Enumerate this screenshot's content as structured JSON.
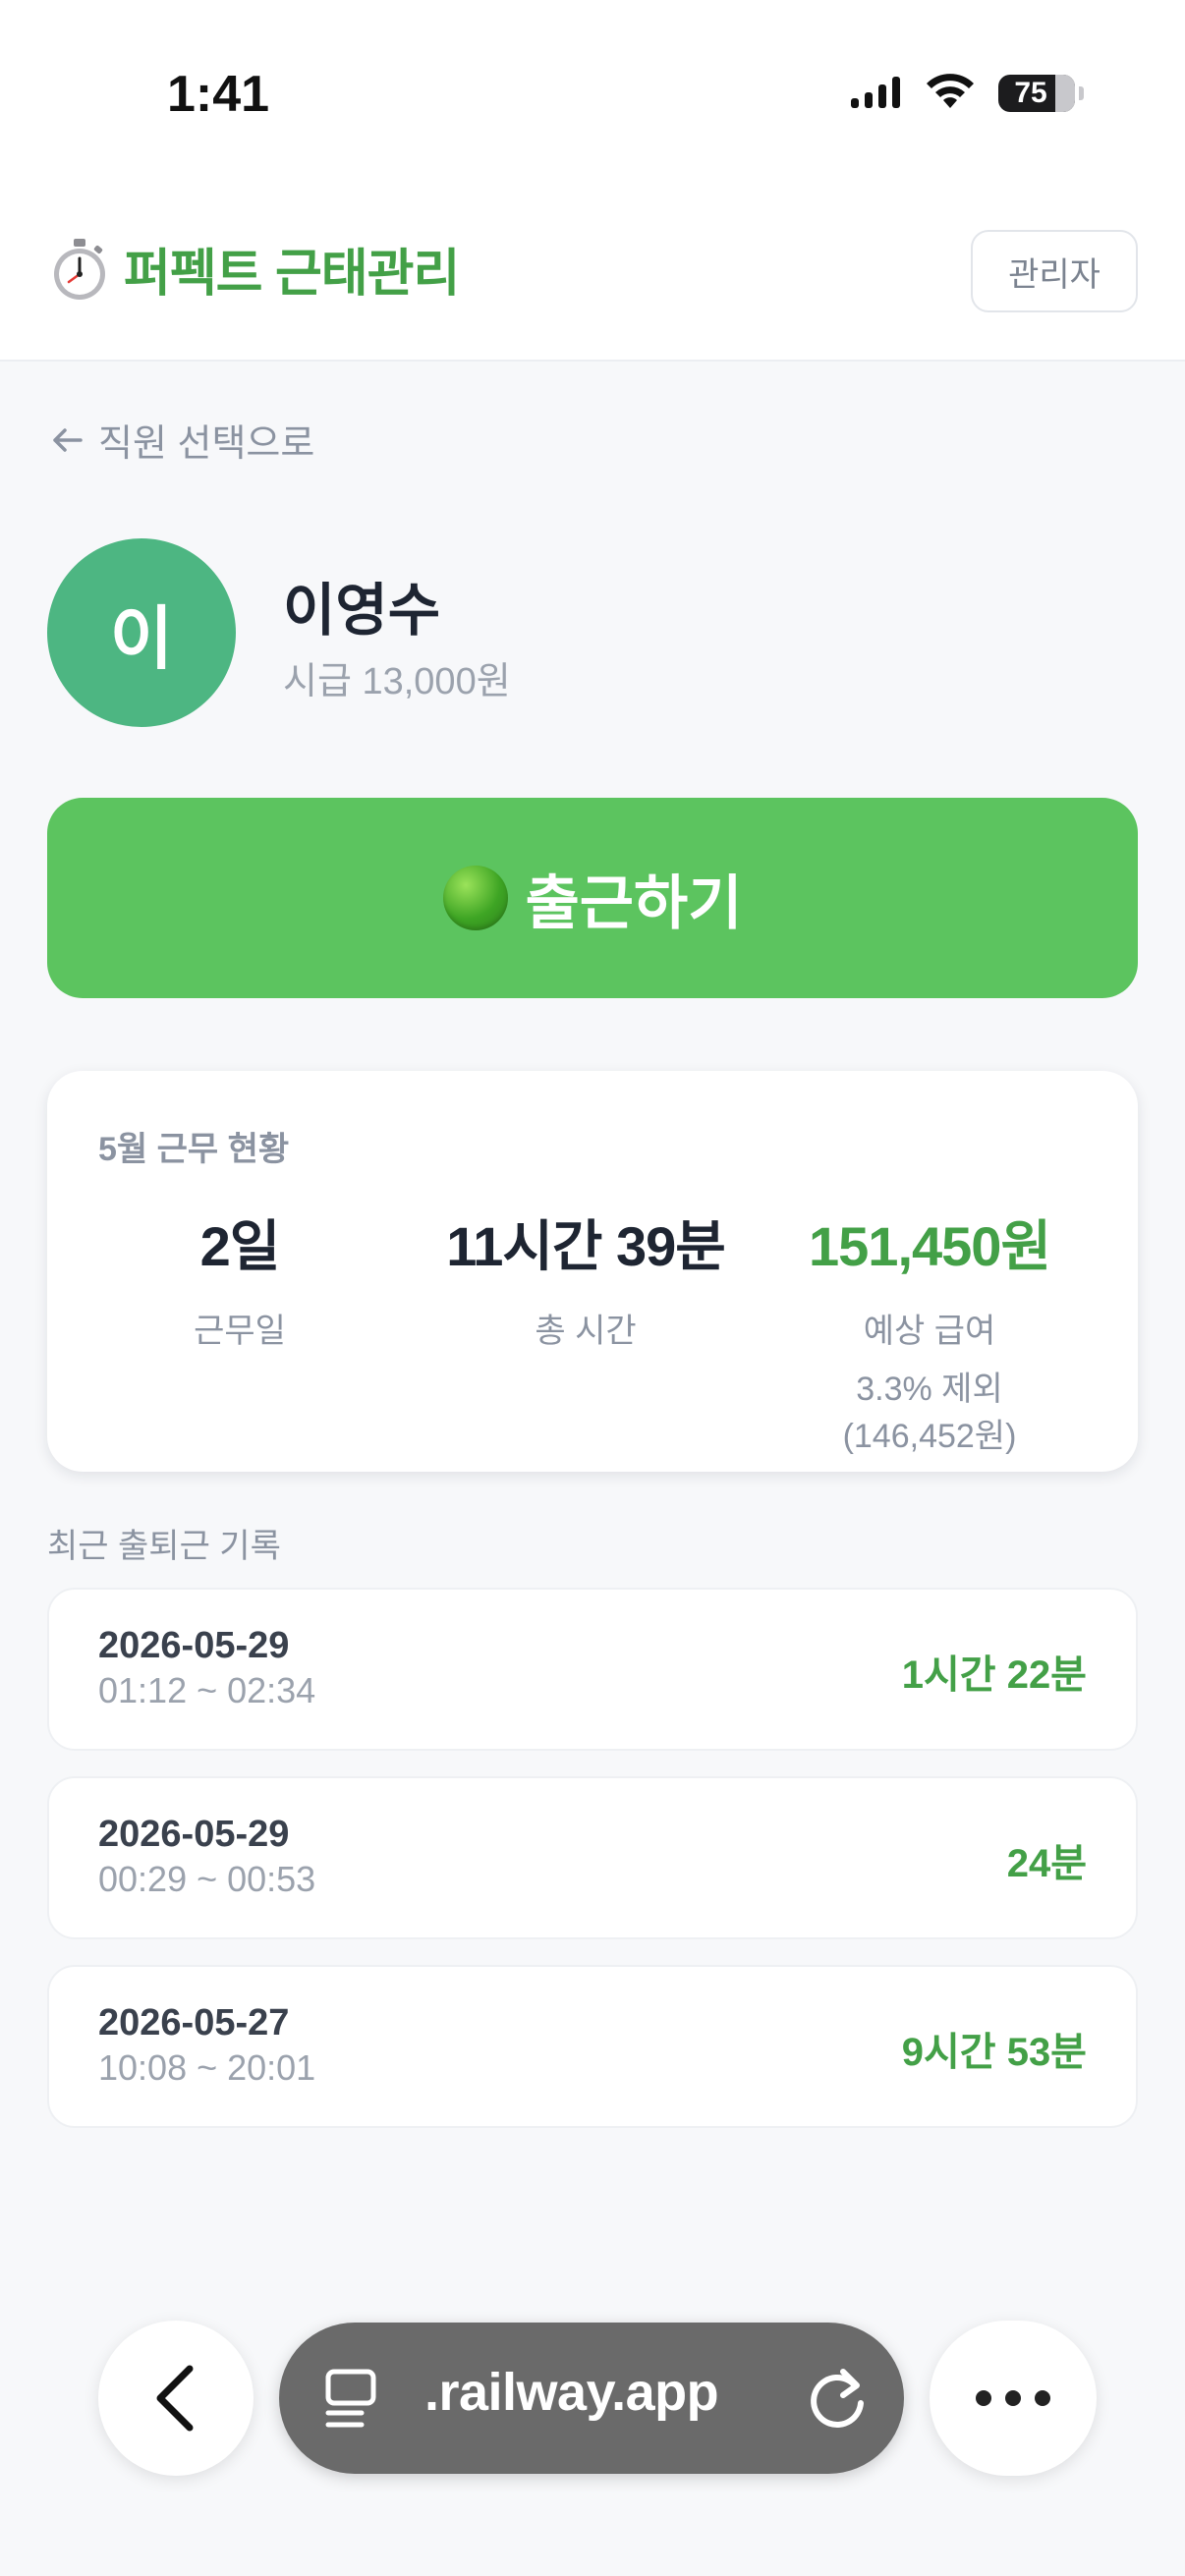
{
  "status_bar": {
    "time": "1:41",
    "battery": "75"
  },
  "header": {
    "brand_title": "퍼펙트 근태관리",
    "admin_label": "관리자"
  },
  "back_link": {
    "label": "직원 선택으로"
  },
  "employee": {
    "initial": "이",
    "name": "이영수",
    "wage": "시급 13,000원"
  },
  "clock_in": {
    "label": "출근하기"
  },
  "summary": {
    "title": "5월 근무 현황",
    "work_days": {
      "value": "2일",
      "label": "근무일"
    },
    "total_time": {
      "value": "11시간 39분",
      "label": "총 시간"
    },
    "expected_pay": {
      "value": "151,450원",
      "label": "예상 급여",
      "note_line1": "3.3% 제외",
      "note_line2": "(146,452원)"
    }
  },
  "records": {
    "title": "최근 출퇴근 기록",
    "items": [
      {
        "date": "2026-05-29",
        "time": "01:12 ~ 02:34",
        "duration": "1시간 22분"
      },
      {
        "date": "2026-05-29",
        "time": "00:29 ~ 00:53",
        "duration": "24분"
      },
      {
        "date": "2026-05-27",
        "time": "10:08 ~ 20:01",
        "duration": "9시간 53분"
      }
    ]
  },
  "browser": {
    "url": ".railway.app"
  },
  "colors": {
    "accent": "#43a047",
    "button": "#5cc45f",
    "avatar": "#4db682"
  }
}
